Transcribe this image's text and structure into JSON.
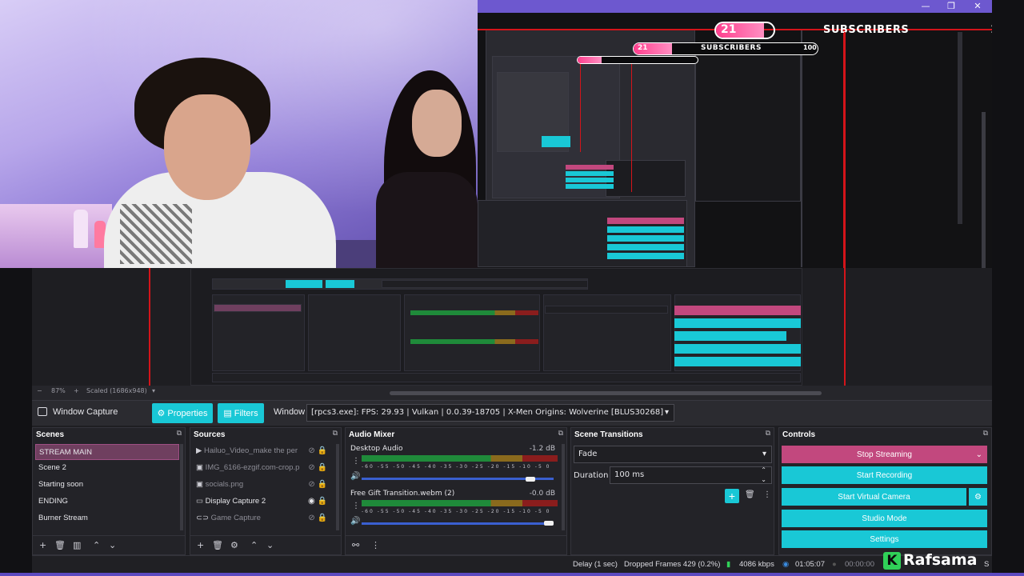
{
  "window": {
    "minimize": "—",
    "maximize": "❐",
    "close": "✕"
  },
  "subscriber_goal": {
    "current": "21",
    "label": "SUBSCRIBERS",
    "goal": "100",
    "progress": 0.21
  },
  "preview": {
    "zoom": "87%",
    "scale_mode": "Scaled (1686x948)",
    "zoom_minus": "−",
    "zoom_plus": "+"
  },
  "context": {
    "source_name": "Window Capture",
    "properties_label": "Properties",
    "filters_label": "Filters",
    "window_label": "Window",
    "window_value": "[rpcs3.exe]: FPS: 29.93 | Vulkan | 0.0.39-18705 | X-Men Origins: Wolverine [BLUS30268]"
  },
  "scenes": {
    "title": "Scenes",
    "items": [
      "STREAM MAIN",
      "Scene 2",
      "Starting soon",
      "ENDING",
      "Burner Stream"
    ],
    "selected": "STREAM MAIN"
  },
  "sources": {
    "title": "Sources",
    "items": [
      {
        "label": "Hailuo_Video_make the per",
        "icon": "play-icon",
        "visible": false
      },
      {
        "label": "IMG_6166-ezgif.com-crop.p",
        "icon": "image-icon",
        "visible": false
      },
      {
        "label": "socials.png",
        "icon": "image-icon",
        "visible": false
      },
      {
        "label": "Display Capture 2",
        "icon": "monitor-icon",
        "visible": true
      },
      {
        "label": "Game Capture",
        "icon": "gamepad-icon",
        "visible": false
      }
    ]
  },
  "audio_mixer": {
    "title": "Audio Mixer",
    "channels": [
      {
        "name": "Desktop Audio",
        "db": "-1.2 dB",
        "volume": 0.9
      },
      {
        "name": "Free Gift Transition.webm (2)",
        "db": "-0.0 dB",
        "volume": 1.0
      }
    ],
    "scale": [
      "-60",
      "-55",
      "-50",
      "-45",
      "-40",
      "-35",
      "-30",
      "-25",
      "-20",
      "-15",
      "-10",
      "-5",
      "0"
    ]
  },
  "scene_transitions": {
    "title": "Scene Transitions",
    "transition": "Fade",
    "duration_label": "Duration",
    "duration_value": "100 ms"
  },
  "controls": {
    "title": "Controls",
    "stop_streaming": "Stop Streaming",
    "start_recording": "Start Recording",
    "start_virtual_camera": "Start Virtual Camera",
    "studio_mode": "Studio Mode",
    "settings": "Settings"
  },
  "status": {
    "delay": "Delay (1 sec)",
    "dropped_frames": "Dropped Frames 429 (0.2%)",
    "bitrate": "4086 kbps",
    "stream_time": "01:05:07",
    "rec_time": "00:00:00",
    "cpu": "S"
  },
  "brand": {
    "text": "Rafsama",
    "k": "K"
  },
  "colors": {
    "accent": "#19c8d6",
    "stop": "#c2487e",
    "selected_scene": "#6f3f5f",
    "titlebar": "#6d58cf",
    "sub_fill": "#ff3f8e"
  }
}
